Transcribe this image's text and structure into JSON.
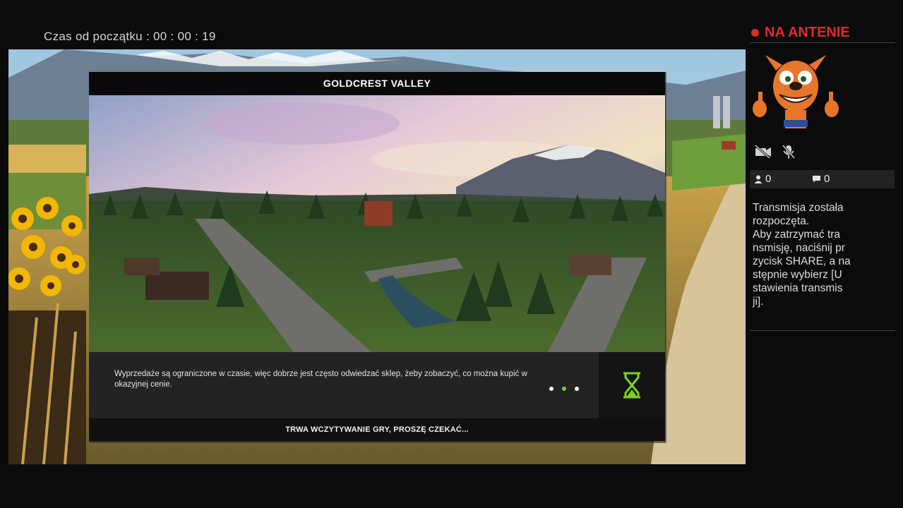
{
  "stream": {
    "elapsed_label": "Czas od początku :",
    "elapsed_time": "00 : 00 : 19"
  },
  "sidebar": {
    "live_label": "NA ANTENIE",
    "viewers": "0",
    "comments": "0",
    "message_lines": [
      "Transmisja została",
      "rozpoczęta.",
      "Aby zatrzymać tra",
      "nsmisję, naciśnij pr",
      "zycisk SHARE, a na",
      "stępnie wybierz [U",
      "stawienia transmis",
      "ji]."
    ],
    "icons": [
      "camera-off-icon",
      "mic-off-icon",
      "person-icon",
      "comment-icon"
    ],
    "live_color": "#e02a2a"
  },
  "loading_screen": {
    "map_title": "GOLDCREST VALLEY",
    "tip": "Wyprzedaże są ograniczone w czasie, więc dobrze jest często odwiedzać sklep, żeby zobaczyć, co można kupić w okazyjnej cenie.",
    "status": "TRWA WCZYTYWANIE GRY, PROSZĘ CZEKAĆ...",
    "progress_dots": 3,
    "active_dot": 2,
    "accent": "#7ed321",
    "icon": "hourglass-icon"
  }
}
